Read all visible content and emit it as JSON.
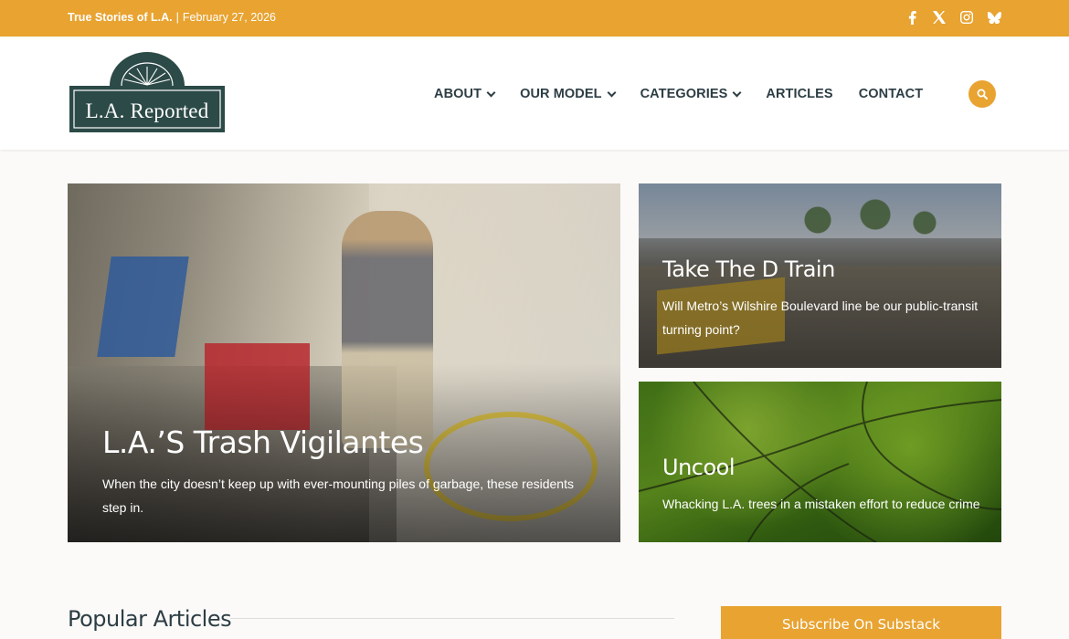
{
  "topbar": {
    "site_tagline": "True Stories of L.A.",
    "separator": "|",
    "date": "February 27, 2026",
    "social": [
      "facebook-icon",
      "x-icon",
      "instagram-icon",
      "bluesky-icon"
    ]
  },
  "header": {
    "logo_text": "L.A. Reported",
    "nav": [
      {
        "label": "ABOUT",
        "has_dropdown": true
      },
      {
        "label": "OUR MODEL",
        "has_dropdown": true
      },
      {
        "label": "CATEGORIES",
        "has_dropdown": true
      },
      {
        "label": "ARTICLES",
        "has_dropdown": false
      },
      {
        "label": "CONTACT",
        "has_dropdown": false
      }
    ],
    "search_icon": "search-icon"
  },
  "features": {
    "main": {
      "title": "L.A.’S Trash Vigilantes",
      "description": "When the city doesn’t keep up with ever-mounting piles of garbage, these residents step in."
    },
    "train": {
      "title": "Take The D Train",
      "description": "Will Metro’s Wilshire Boulevard line be our public-transit turning point?"
    },
    "trees": {
      "title": "Uncool",
      "description": "Whacking L.A. trees in a mistaken effort to reduce crime"
    }
  },
  "sections": {
    "popular_title": "Popular Articles",
    "subscribe_label": "Subscribe On Substack"
  },
  "colors": {
    "accent": "#e8a331",
    "logo_green": "#2c4a47",
    "nav_text": "#2d3d44"
  }
}
